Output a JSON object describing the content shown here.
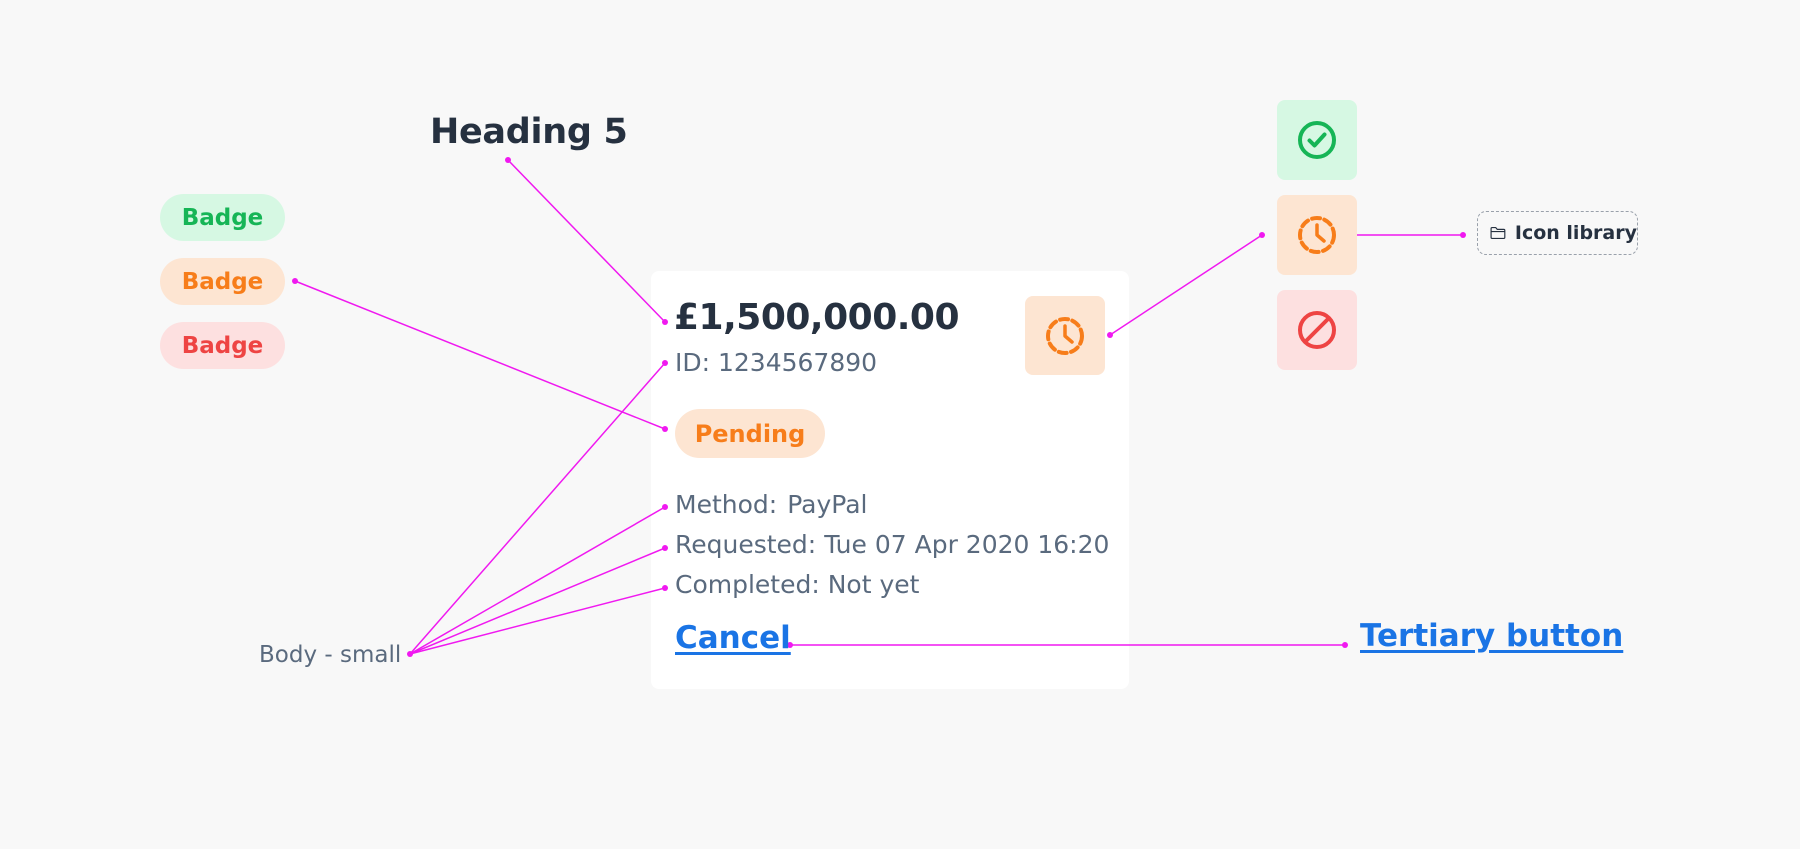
{
  "annotations": {
    "heading_label": "Heading 5",
    "body_small_label": "Body - small",
    "tertiary_button_label": "Tertiary button",
    "icon_library_label": "Icon library"
  },
  "badges": [
    {
      "label": "Badge",
      "variant": "success"
    },
    {
      "label": "Badge",
      "variant": "warning"
    },
    {
      "label": "Badge",
      "variant": "danger"
    }
  ],
  "card": {
    "amount": "£1,500,000.00",
    "id_label": "ID: 1234567890",
    "status_badge": "Pending",
    "status_icon": "clock-pending-icon",
    "method": {
      "label": "Method:",
      "value": "PayPal"
    },
    "requested": {
      "label": "Requested:",
      "value": "Tue 07 Apr 2020 16:20"
    },
    "completed": {
      "label": "Completed:",
      "value": "Not yet"
    },
    "cancel_label": "Cancel"
  },
  "icon_tiles": [
    {
      "icon": "check-circle-icon",
      "variant": "success"
    },
    {
      "icon": "clock-pending-icon",
      "variant": "warning"
    },
    {
      "icon": "prohibited-icon",
      "variant": "danger"
    }
  ],
  "colors": {
    "background": "#f8f8f8",
    "card": "#ffffff",
    "text_dark": "#263140",
    "text_muted": "#5a6a7e",
    "success": "#16b556",
    "success_bg": "#d6f8e3",
    "warning": "#f77d1a",
    "warning_bg": "#fde5d2",
    "danger": "#ee4443",
    "danger_bg": "#fde0e0",
    "link": "#1a74e5",
    "connector": "#f019f0"
  }
}
